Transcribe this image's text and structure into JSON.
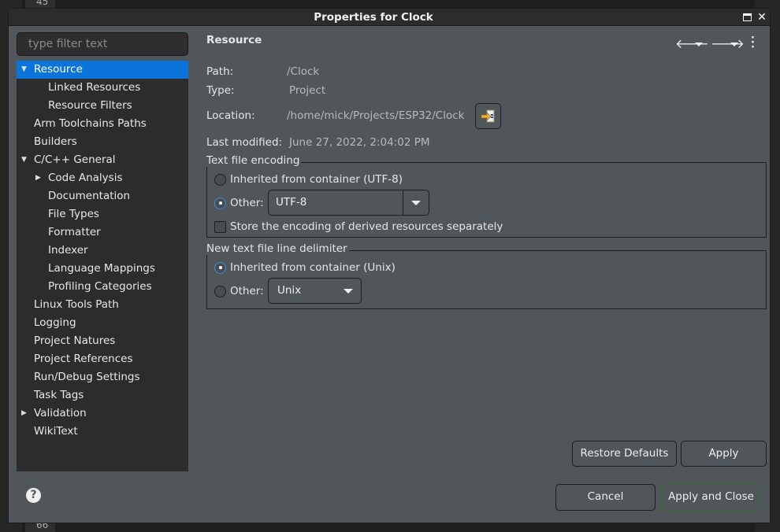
{
  "background": {
    "line_top": "45",
    "line_bottom": "66"
  },
  "dialog": {
    "title": "Properties for Clock",
    "filter_placeholder": "type filter text"
  },
  "tree": [
    {
      "label": "Resource",
      "level": 0,
      "expander": "expanded",
      "selected": true
    },
    {
      "label": "Linked Resources",
      "level": 1
    },
    {
      "label": "Resource Filters",
      "level": 1
    },
    {
      "label": "Arm Toolchains Paths",
      "level": 0
    },
    {
      "label": "Builders",
      "level": 0
    },
    {
      "label": "C/C++ General",
      "level": 0,
      "expander": "expanded"
    },
    {
      "label": "Code Analysis",
      "level": 1,
      "expander": "collapsed"
    },
    {
      "label": "Documentation",
      "level": 1
    },
    {
      "label": "File Types",
      "level": 1
    },
    {
      "label": "Formatter",
      "level": 1
    },
    {
      "label": "Indexer",
      "level": 1
    },
    {
      "label": "Language Mappings",
      "level": 1
    },
    {
      "label": "Profiling Categories",
      "level": 1
    },
    {
      "label": "Linux Tools Path",
      "level": 0
    },
    {
      "label": "Logging",
      "level": 0
    },
    {
      "label": "Project Natures",
      "level": 0
    },
    {
      "label": "Project References",
      "level": 0
    },
    {
      "label": "Run/Debug Settings",
      "level": 0
    },
    {
      "label": "Task Tags",
      "level": 0
    },
    {
      "label": "Validation",
      "level": 0,
      "expander": "collapsed"
    },
    {
      "label": "WikiText",
      "level": 0
    }
  ],
  "page": {
    "title": "Resource",
    "path_label": "Path:",
    "path_value": "/Clock",
    "type_label": "Type:",
    "type_value": "Project",
    "location_label": "Location:",
    "location_value": "/home/mick/Projects/ESP32/Clock",
    "modified_label": "Last modified:",
    "modified_value": "June 27, 2022, 2:04:02 PM",
    "encoding": {
      "legend": "Text file encoding",
      "inherited": "Inherited from container (UTF-8)",
      "other": "Other:",
      "other_value": "UTF-8",
      "selected": "other",
      "store_separately": "Store the encoding of derived resources separately",
      "store_checked": false
    },
    "delimiter": {
      "legend": "New text file line delimiter",
      "inherited": "Inherited from container (Unix)",
      "other": "Other:",
      "other_value": "Unix",
      "selected": "inherited"
    }
  },
  "buttons": {
    "restore": "Restore Defaults",
    "apply": "Apply",
    "cancel": "Cancel",
    "apply_close": "Apply and Close"
  },
  "colors": {
    "selection": "#0a74da",
    "default_button_border": "#2e6b2e"
  }
}
